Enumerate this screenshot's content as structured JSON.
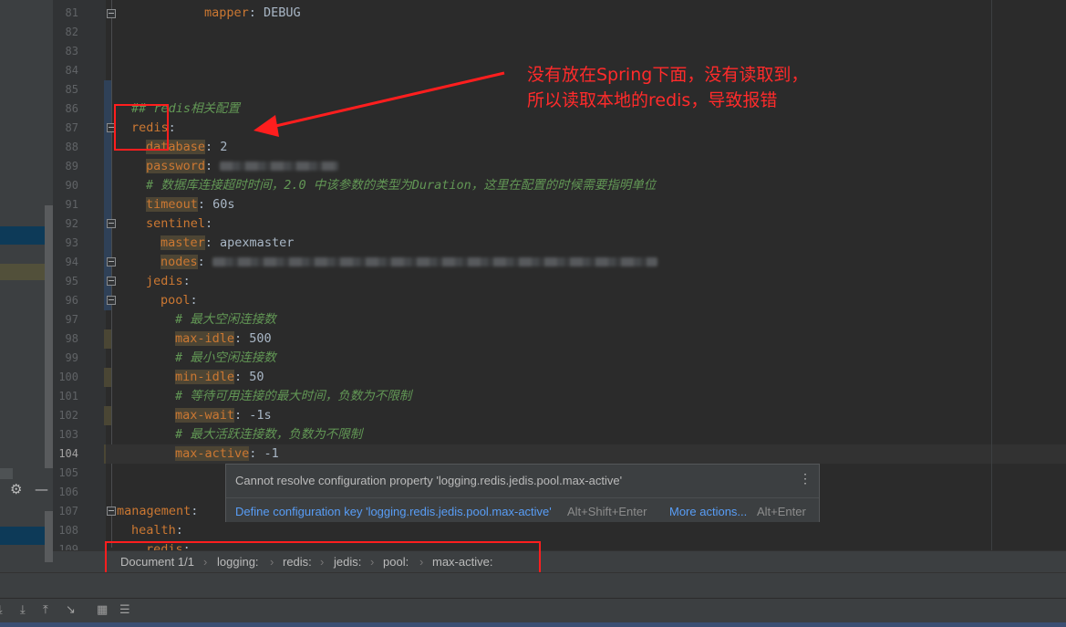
{
  "line_numbers": [
    "81",
    "82",
    "83",
    "84",
    "85",
    "86",
    "87",
    "88",
    "89",
    "90",
    "91",
    "92",
    "93",
    "94",
    "95",
    "96",
    "97",
    "98",
    "99",
    "100",
    "101",
    "102",
    "103",
    "104",
    "105",
    "106",
    "107",
    "108",
    "109"
  ],
  "code": {
    "l81_key": "mapper",
    "l81_val": "DEBUG",
    "l86_comment": "## redis相关配置",
    "l87_key": "redis",
    "l88_key": "database",
    "l88_val": "2",
    "l89_key": "password",
    "l90_comment": "# 数据库连接超时时间，2.0 中该参数的类型为Duration，这里在配置的时候需要指明单位",
    "l91_key": "timeout",
    "l91_val": "60s",
    "l92_key": "sentinel",
    "l93_key": "master",
    "l93_val": "apexmaster",
    "l94_key": "nodes",
    "l95_key": "jedis",
    "l96_key": "pool",
    "l97_comment": "# 最大空闲连接数",
    "l98_key": "max-idle",
    "l98_val": "500",
    "l99_comment": "# 最小空闲连接数",
    "l100_key": "min-idle",
    "l100_val": "50",
    "l101_comment": "# 等待可用连接的最大时间，负数为不限制",
    "l102_key": "max-wait",
    "l102_val": "-1s",
    "l103_comment": "# 最大活跃连接数，负数为不限制",
    "l104_key": "max-active",
    "l104_val": "-1",
    "l107_key": "management",
    "l108_key": "health",
    "l109_key": "redis"
  },
  "annotation": {
    "line1": "没有放在Spring下面，没有读取到，",
    "line2": "所以读取本地的redis，导致报错"
  },
  "popup": {
    "message": "Cannot resolve configuration property 'logging.redis.jedis.pool.max-active'",
    "define_action": "Define configuration key 'logging.redis.jedis.pool.max-active'",
    "define_shortcut": "Alt+Shift+Enter",
    "more_actions": "More actions...",
    "more_shortcut": "Alt+Enter"
  },
  "breadcrumbs": [
    "Document 1/1",
    "logging:",
    "redis:",
    "jedis:",
    "pool:",
    "max-active:"
  ],
  "colors": {
    "annotation_red": "#ff1e1e",
    "key_orange": "#cc7832",
    "comment_green": "#629755",
    "link_blue": "#589df6"
  },
  "icons": [
    "gear-icon",
    "minimize-icon",
    "download-icon",
    "download-all-icon",
    "upload-icon",
    "merge-icon",
    "grid-icon",
    "filter-icon",
    "more-vertical-icon",
    "fold-icon",
    "arrow-annotation-icon"
  ]
}
